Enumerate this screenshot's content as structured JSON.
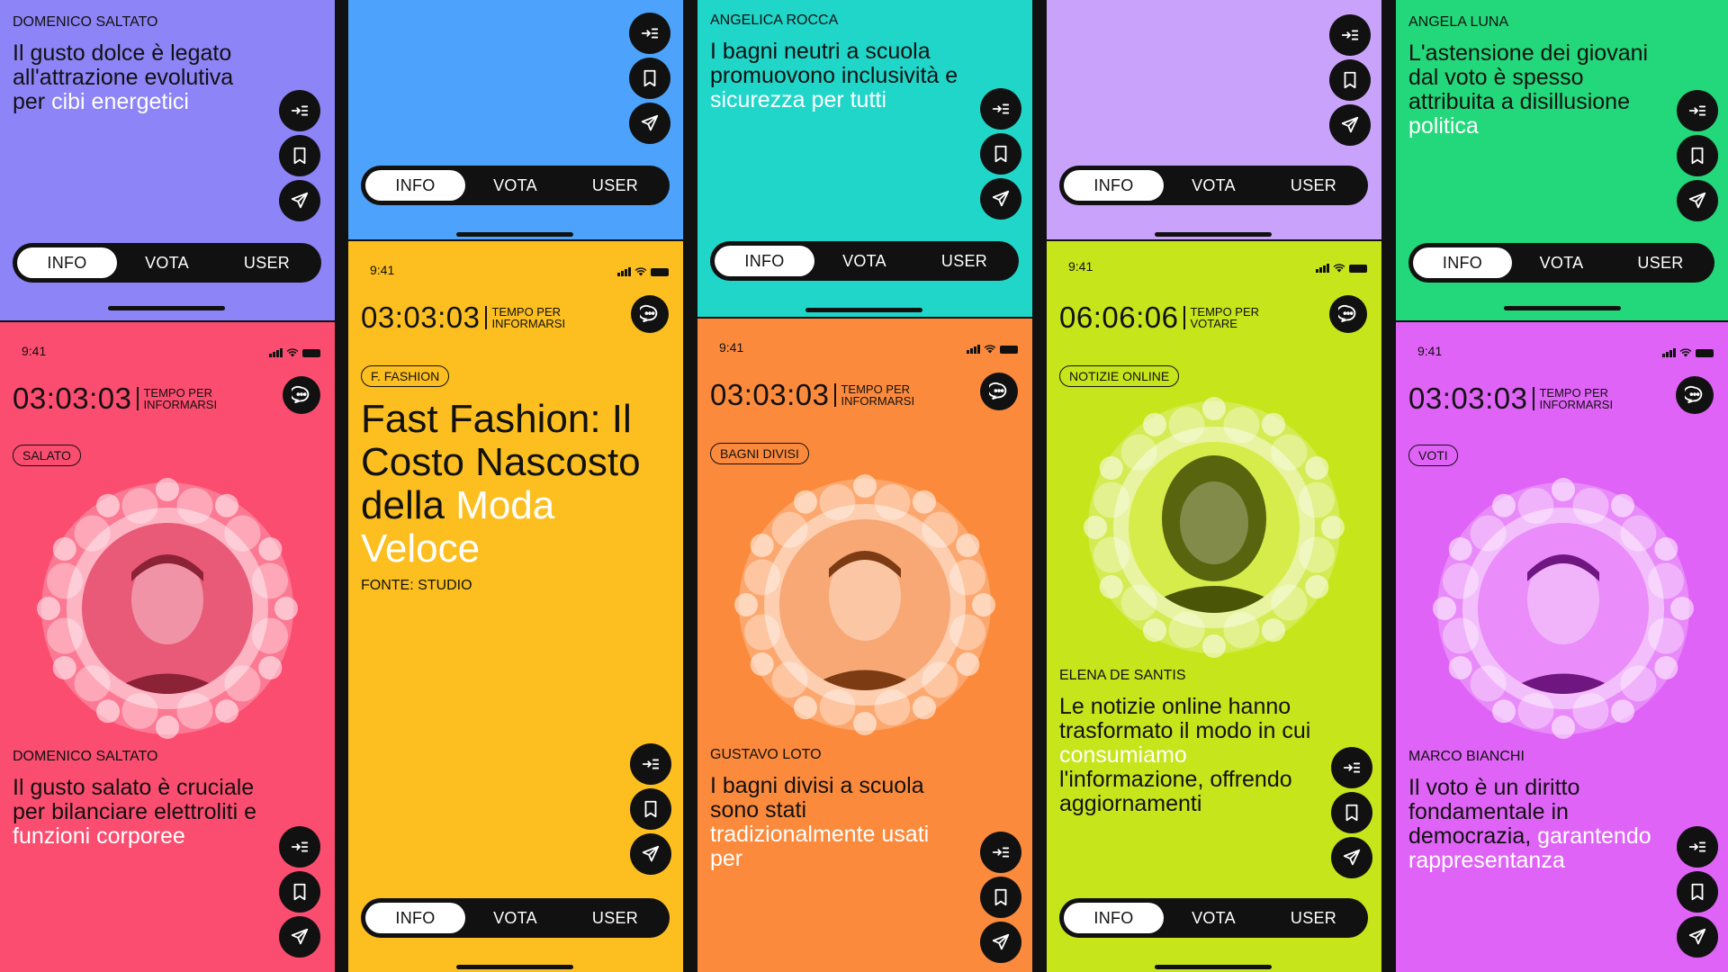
{
  "nav": {
    "tabs": [
      "INFO",
      "VOTA",
      "USER"
    ],
    "active": "INFO"
  },
  "status": {
    "time": "9:41"
  },
  "timer_label_info": [
    "TEMPO PER",
    "INFORMARSI"
  ],
  "timer_label_vote": [
    "TEMPO PER",
    "VOTARE"
  ],
  "colors": {
    "violet": "#8d84f7",
    "blue": "#4da3fb",
    "teal": "#1fd6c9",
    "lavender": "#c9a3fb",
    "green": "#22d87a",
    "coral": "#fb4d6f",
    "yellow": "#fdbf1f",
    "orange": "#fb8a3c",
    "lime": "#c7e51b",
    "magenta": "#e063f7"
  },
  "col1": {
    "top": {
      "author": "DOMENICO SALTATO",
      "headline_plain": "Il gusto dolce è legato all'attrazione evolutiva per ",
      "headline_hl": "cibi energetici"
    },
    "bottom": {
      "clock": "03:03:03",
      "tag": "SALATO",
      "author": "DOMENICO SALTATO",
      "headline_plain": "Il gusto salato è cruciale per bilanciare elettroliti e ",
      "headline_hl": "funzioni corporee"
    }
  },
  "col2": {
    "bottom": {
      "clock": "03:03:03",
      "tag": "F. FASHION",
      "title_plain": "Fast Fashion: Il Costo Nascosto della ",
      "title_hl": "Moda Veloce",
      "source": "FONTE: STUDIO"
    }
  },
  "col3": {
    "top": {
      "author": "ANGELICA ROCCA",
      "headline_plain": "I bagni neutri a scuola promuovono inclusività e ",
      "headline_hl": "sicurezza per tutti"
    },
    "bottom": {
      "clock": "03:03:03",
      "tag": "BAGNI DIVISI",
      "author": "GUSTAVO LOTO",
      "headline_plain": "I bagni divisi a scuola sono stati ",
      "headline_hl": "tradizionalmente usati per"
    }
  },
  "col4": {
    "bottom": {
      "clock": "06:06:06",
      "tag": "NOTIZIE ONLINE",
      "author": "ELENA DE SANTIS",
      "headline_plain": "Le notizie online hanno trasformato il modo in cui ",
      "headline_hl": "consumiamo",
      "headline_tail": " l'informazione, offrendo aggiornamenti"
    }
  },
  "col5": {
    "top": {
      "author": "ANGELA LUNA",
      "headline_plain": "L'astensione dei giovani dal voto è spesso attribuita a disillusione ",
      "headline_hl": "politica"
    },
    "bottom": {
      "clock": "03:03:03",
      "tag": "VOTI",
      "author": "MARCO BIANCHI",
      "headline_plain": "Il voto è un diritto fondamentale in democrazia, ",
      "headline_hl": "garantendo rappresentanza"
    }
  }
}
